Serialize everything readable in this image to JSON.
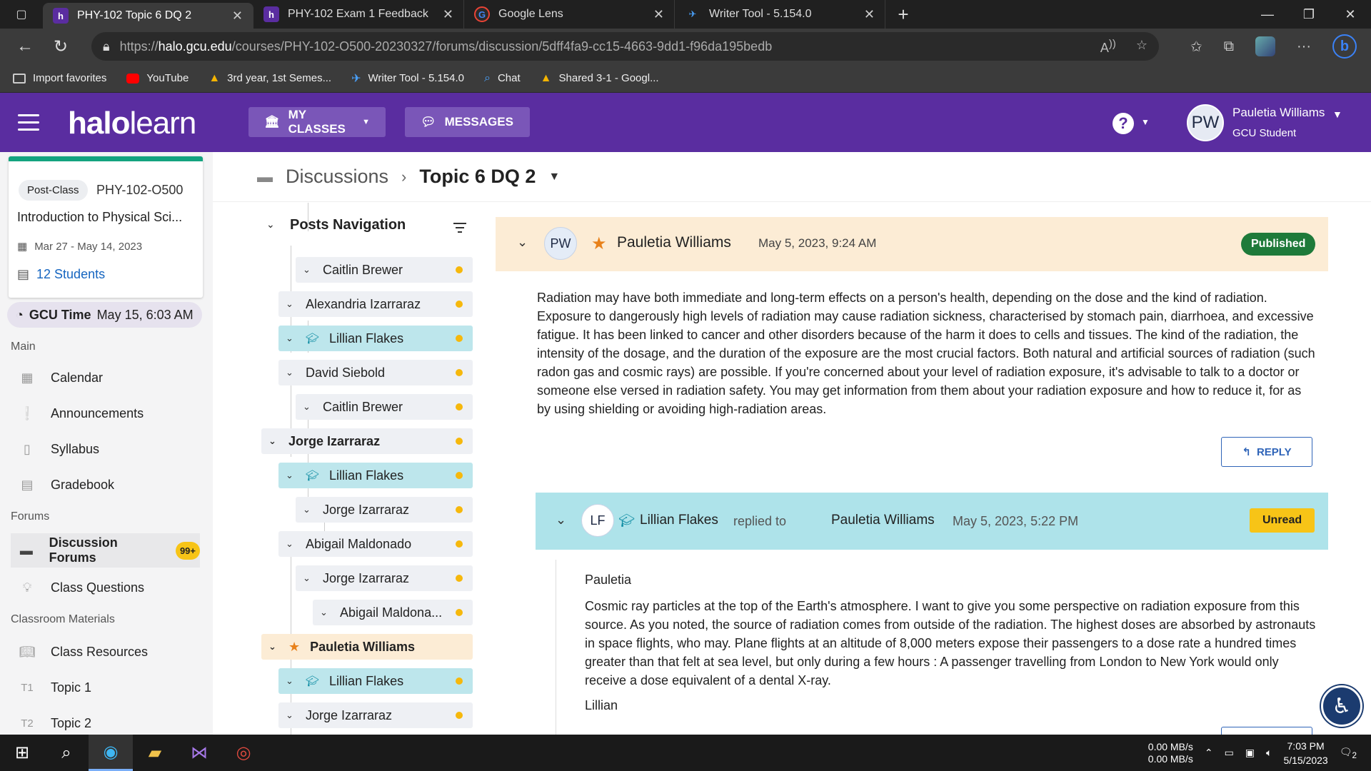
{
  "browser": {
    "tabs": [
      {
        "title": "PHY-102 Topic 6 DQ 2",
        "favicon": "h",
        "fav_bg": "#5a2da0",
        "active": true
      },
      {
        "title": "PHY-102 Exam 1 Feedback",
        "favicon": "h",
        "fav_bg": "#5a2da0",
        "active": false
      },
      {
        "title": "Google Lens",
        "favicon": "G",
        "fav_bg": "#2a2a2a",
        "active": false
      },
      {
        "title": "Writer Tool - 5.154.0",
        "favicon": "✈",
        "fav_bg": "#202020",
        "active": false
      }
    ],
    "url": {
      "prefix": "https://",
      "host": "halo.gcu.edu",
      "path": "/courses/PHY-102-O500-20230327/forums/discussion/5dff4fa9-cc15-4663-9dd1-f96da195bedb"
    },
    "favorites": [
      {
        "label": "Import favorites",
        "color": "#cccccc"
      },
      {
        "label": "YouTube",
        "color": "#ff0000"
      },
      {
        "label": "3rd year, 1st Semes...",
        "color": "#f4b400"
      },
      {
        "label": "Writer Tool - 5.154.0",
        "color": "#4aa3ff"
      },
      {
        "label": "Chat",
        "color": "#4aa3ff"
      },
      {
        "label": "Shared 3-1 - Googl...",
        "color": "#f4b400"
      }
    ]
  },
  "header": {
    "logo_bold": "halo",
    "logo_light": "learn",
    "my_classes": "MY CLASSES",
    "messages": "MESSAGES",
    "help": "?",
    "user_initials": "PW",
    "user_name": "Pauletia Williams",
    "user_role": "GCU Student"
  },
  "sidebar": {
    "course": {
      "status": "Post-Class",
      "code": "PHY-102-O500",
      "name": "Introduction to Physical Sci...",
      "dates": "Mar 27 - May 14, 2023",
      "students": "12 Students"
    },
    "gcu_time_label": "GCU Time",
    "gcu_time_value": "May 15, 6:03 AM",
    "sections": {
      "main": "Main",
      "forums": "Forums",
      "classroom": "Classroom Materials"
    },
    "main_items": [
      "Calendar",
      "Announcements",
      "Syllabus",
      "Gradebook"
    ],
    "forum_items": {
      "discussion": "Discussion Forums",
      "badge": "99+",
      "questions": "Class Questions"
    },
    "material_items": [
      {
        "prefix": "",
        "label": "Class Resources"
      },
      {
        "prefix": "T1",
        "label": "Topic 1"
      },
      {
        "prefix": "T2",
        "label": "Topic 2"
      }
    ]
  },
  "breadcrumb": {
    "root": "Discussions",
    "current": "Topic 6 DQ 2"
  },
  "posts_nav": {
    "title": "Posts Navigation",
    "items": [
      {
        "name": "Caitlin Brewer"
      },
      {
        "name": "Alexandria Izarraraz"
      },
      {
        "name": "Lillian Flakes"
      },
      {
        "name": "David Siebold"
      },
      {
        "name": "Caitlin Brewer"
      },
      {
        "name": "Jorge Izarraraz"
      },
      {
        "name": "Lillian Flakes"
      },
      {
        "name": "Jorge Izarraraz"
      },
      {
        "name": "Abigail Maldonado"
      },
      {
        "name": "Jorge Izarraraz"
      },
      {
        "name": "Abigail Maldona..."
      },
      {
        "name": "Pauletia Williams"
      },
      {
        "name": "Lillian Flakes"
      },
      {
        "name": "Jorge Izarraraz"
      }
    ]
  },
  "post": {
    "initials": "PW",
    "author": "Pauletia Williams",
    "date": "May 5, 2023, 9:24 AM",
    "status": "Published",
    "body": "Radiation may have both immediate and long-term effects on a person's health, depending on the dose and the kind of radiation. Exposure to dangerously high levels of radiation may cause radiation sickness, characterised by stomach pain, diarrhoea, and excessive fatigue. It has been linked to cancer and other disorders because of the harm it does to cells and tissues. The kind of the radiation, the intensity of the dosage, and the duration of the exposure are the most crucial factors. Both natural and artificial sources of radiation (such radon gas and cosmic rays) are possible. If you're concerned about your level of radiation exposure, it's advisable to talk to a doctor or someone else versed in radiation safety. You may get information from them about your radiation exposure and how to reduce it, for as by using shielding or avoiding high-radiation areas.",
    "reply_label": "REPLY"
  },
  "reply": {
    "initials": "LF",
    "author": "Lillian Flakes",
    "replied_to": "replied to",
    "target": "Pauletia Williams",
    "date": "May 5, 2023, 5:22 PM",
    "status": "Unread",
    "greeting": "Pauletia",
    "body": "Cosmic ray particles at the top of the Earth's atmosphere. I want to give you some perspective on radiation exposure from this source. As you noted, the source of radiation comes from outside of the radiation. The highest doses are absorbed by astronauts in space flights, who may. Plane flights at an altitude of 8,000 meters expose their passengers to a dose rate a hundred times greater than that felt at sea level, but only during a few hours : A passenger travelling from London to New York would only receive a dose equivalent of a dental X-ray.",
    "signature": "Lillian"
  },
  "taskbar": {
    "net_up": "0.00 MB/s",
    "net_down": "0.00 MB/s",
    "time": "7:03 PM",
    "date": "5/15/2023",
    "notif_count": "2"
  }
}
